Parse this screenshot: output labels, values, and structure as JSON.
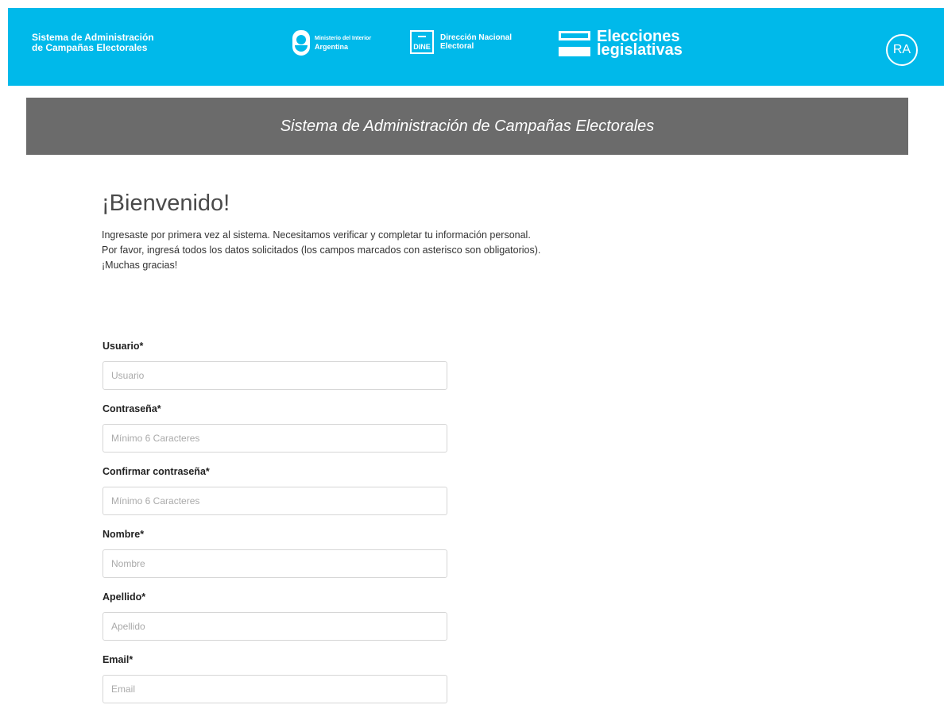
{
  "header": {
    "app_name_line1": "Sistema de Administración",
    "app_name_line2": "de Campañas Electorales",
    "ministerio_line1": "Ministerio del Interior",
    "ministerio_line2": "Argentina",
    "dine_mark": "DINE",
    "dine_line1": "Dirección Nacional",
    "dine_line2": "Electoral",
    "elecciones_line1": "Elecciones",
    "elecciones_line2": "legislativas",
    "ra_badge": "RA",
    "bg_color": "#00b9ea",
    "icons": [
      "escudo-nacional-icon",
      "dine-logo-icon",
      "elecciones-logo-icon"
    ]
  },
  "banner": {
    "title": "Sistema de Administración de Campañas Electorales",
    "bg_color": "#6b6b6b"
  },
  "welcome": {
    "title": "¡Bienvenido!",
    "line1": "Ingresaste por primera vez al sistema. Necesitamos verificar y completar tu información personal.",
    "line2": "Por favor, ingresá todos los datos solicitados (los campos marcados con asterisco son obligatorios).",
    "line3": "¡Muchas gracias!"
  },
  "form": {
    "fields": [
      {
        "label": "Usuario*",
        "placeholder": "Usuario",
        "value": ""
      },
      {
        "label": "Contraseña*",
        "placeholder": "Mínimo 6 Caracteres",
        "value": ""
      },
      {
        "label": "Confirmar contraseña*",
        "placeholder": "Mínimo 6 Caracteres",
        "value": ""
      },
      {
        "label": "Nombre*",
        "placeholder": "Nombre",
        "value": ""
      },
      {
        "label": "Apellido*",
        "placeholder": "Apellido",
        "value": ""
      },
      {
        "label": "Email*",
        "placeholder": "Email",
        "value": ""
      }
    ]
  }
}
